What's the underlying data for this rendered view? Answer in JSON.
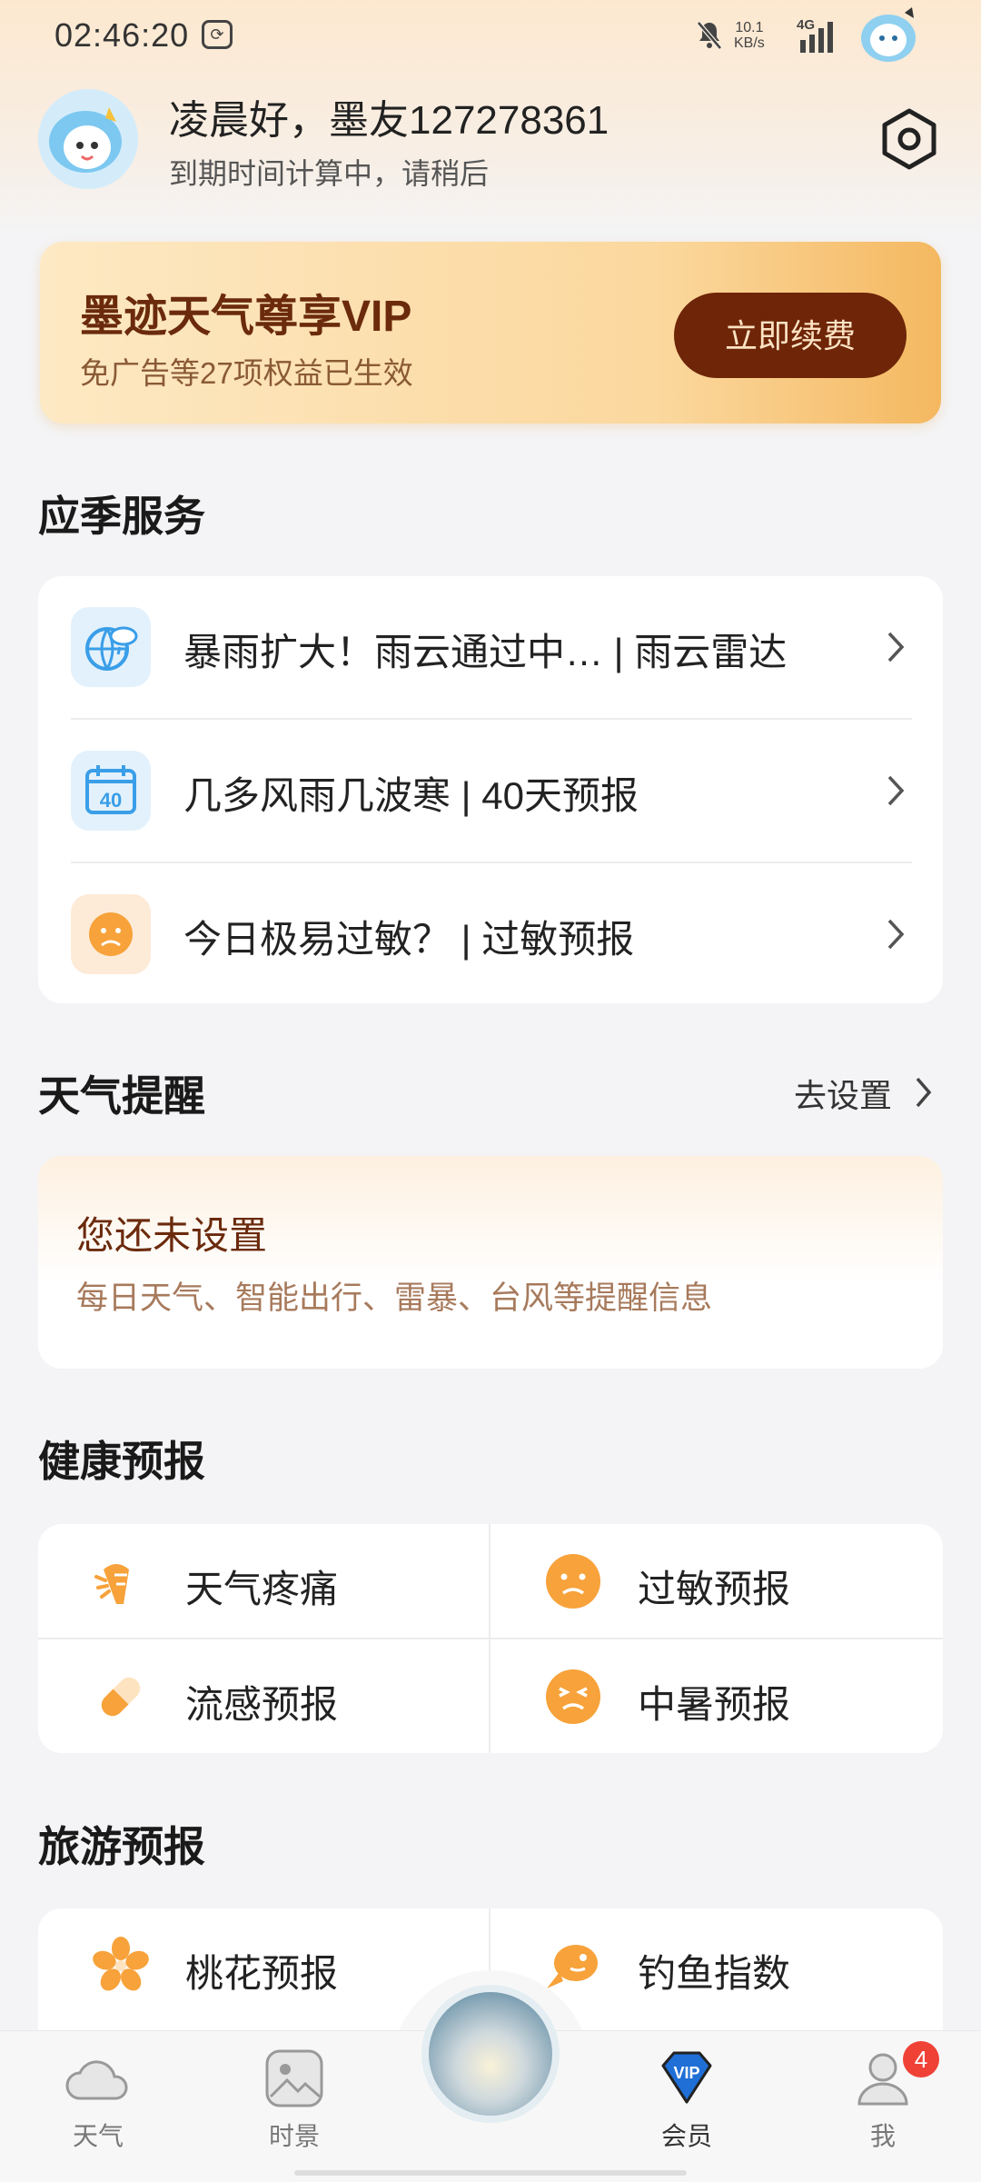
{
  "status_bar": {
    "time": "02:46:20",
    "speed_value": "10.1",
    "speed_unit": "KB/s",
    "network": "4G"
  },
  "header": {
    "greeting": "凌晨好，墨友127278361",
    "subtitle": "到期时间计算中，请稍后"
  },
  "vip_card": {
    "title": "墨迹天气尊享VIP",
    "subtitle": "免广告等27项权益已生效",
    "button": "立即续费"
  },
  "seasonal_services": {
    "title": "应季服务",
    "items": [
      {
        "label": "暴雨扩大！雨云通过中… | 雨云雷达",
        "icon": "rain-radar-icon"
      },
      {
        "label": "几多风雨几波寒 | 40天预报",
        "icon": "calendar-40-icon"
      },
      {
        "label": "今日极易过敏？ | 过敏预报",
        "icon": "allergy-face-icon"
      }
    ]
  },
  "weather_reminder": {
    "title": "天气提醒",
    "action": "去设置",
    "card_title": "您还未设置",
    "card_sub": "每日天气、智能出行、雷暴、台风等提醒信息"
  },
  "health_forecast": {
    "title": "健康预报",
    "items": [
      {
        "label": "天气疼痛",
        "icon": "joint-pain-icon"
      },
      {
        "label": "过敏预报",
        "icon": "allergy-face-icon"
      },
      {
        "label": "流感预报",
        "icon": "pill-icon"
      },
      {
        "label": "中暑预报",
        "icon": "heatstroke-face-icon"
      }
    ]
  },
  "travel_forecast": {
    "title": "旅游预报",
    "items": [
      {
        "label": "桃花预报",
        "icon": "peach-blossom-icon"
      },
      {
        "label": "钓鱼指数",
        "icon": "fish-icon"
      }
    ]
  },
  "bottom_nav": {
    "items": [
      {
        "label": "天气",
        "icon": "cloud-icon"
      },
      {
        "label": "时景",
        "icon": "image-icon"
      },
      {
        "label": "会员",
        "icon": "vip-diamond-icon"
      },
      {
        "label": "我",
        "icon": "person-icon"
      }
    ],
    "badge_count": "4"
  },
  "colors": {
    "accent_brown": "#6e2508",
    "vip_gold": "#fbd79c",
    "icon_orange": "#f7a23a",
    "icon_blue": "#3a9ee8"
  }
}
